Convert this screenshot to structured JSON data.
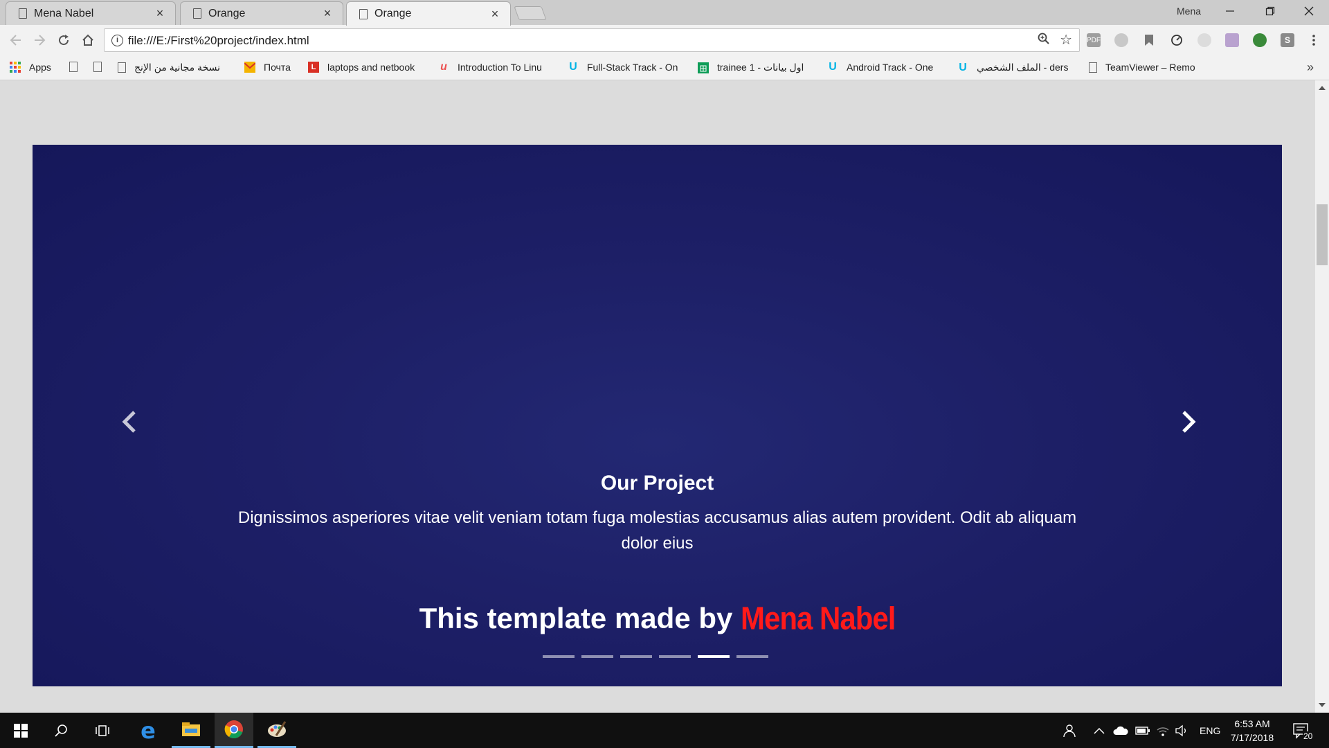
{
  "browser": {
    "tabs": [
      {
        "title": "Mena Nabel",
        "active": false
      },
      {
        "title": "Orange",
        "active": false
      },
      {
        "title": "Orange",
        "active": true
      }
    ],
    "close_glyph": "×",
    "user_label": "Mena",
    "url": "file:///E:/First%20project/index.html"
  },
  "bookmarks": {
    "apps_label": "Apps",
    "items": [
      {
        "label": "نسخة مجانية من الإنج",
        "icon": "page-icon"
      },
      {
        "label": "Почта",
        "icon": "mail-icon"
      },
      {
        "label": "laptops and netbook",
        "icon": "l-icon"
      },
      {
        "label": "Introduction To Linu",
        "icon": "udemy-icon"
      },
      {
        "label": "Full-Stack Track - On",
        "icon": "udacity-icon"
      },
      {
        "label": "trainee 1 - اول بيانات",
        "icon": "sheets-icon"
      },
      {
        "label": "Android Track - One",
        "icon": "udacity-icon"
      },
      {
        "label": "الملف الشخصي - ders",
        "icon": "udacity-icon"
      },
      {
        "label": "TeamViewer – Remo",
        "icon": "page-icon"
      }
    ],
    "more": "»"
  },
  "page": {
    "caption_title": "Our Project",
    "caption_text": "Dignissimos asperiores vitae velit veniam totam fuga molestias accusamus alias autem provident. Odit ab aliquam dolor eius",
    "credit_prefix": "This template made by",
    "credit_author": "Mena Nabel",
    "indicator_count": 6,
    "active_indicator": 5,
    "colors": {
      "slide_bg": "#1d1f66",
      "author": "#ff1a1a"
    }
  },
  "taskbar": {
    "language": "ENG",
    "time": "6:53 AM",
    "date": "7/17/2018",
    "notification_count": "20"
  }
}
